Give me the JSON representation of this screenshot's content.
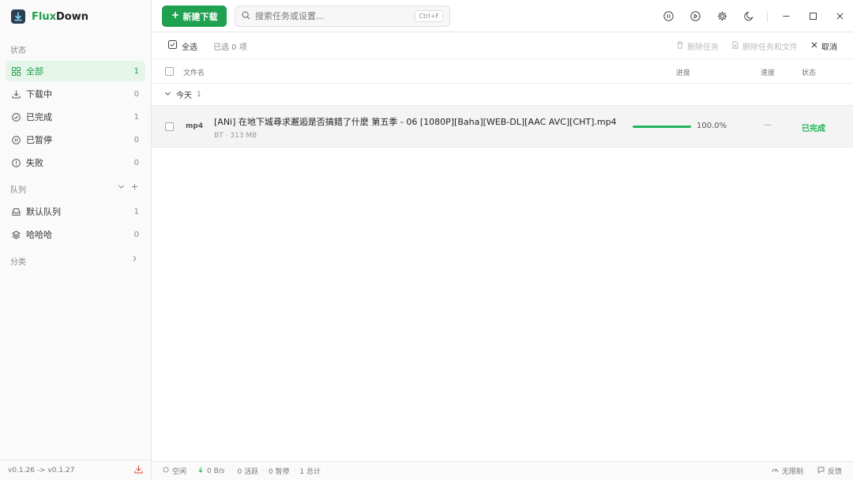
{
  "app": {
    "brand_prefix": "Flux",
    "brand_suffix": "Down"
  },
  "header": {
    "new_task_label": "新建下载",
    "search_placeholder": "搜索任务或设置...",
    "search_shortcut": "Ctrl+F"
  },
  "sidebar": {
    "status_label": "状态",
    "status_items": [
      {
        "label": "全部",
        "count": "1",
        "icon": "grid-icon"
      },
      {
        "label": "下载中",
        "count": "0",
        "icon": "download-icon"
      },
      {
        "label": "已完成",
        "count": "1",
        "icon": "check-circle-icon"
      },
      {
        "label": "已暂停",
        "count": "0",
        "icon": "pause-circle-icon"
      },
      {
        "label": "失败",
        "count": "0",
        "icon": "alert-circle-icon"
      }
    ],
    "queue_label": "队列",
    "queue_items": [
      {
        "label": "默认队列",
        "count": "1",
        "icon": "inbox-icon"
      },
      {
        "label": "哈哈哈",
        "count": "0",
        "icon": "layers-icon"
      }
    ],
    "category_label": "分类",
    "version": "v0.1.26 -> v0.1.27"
  },
  "toolbar": {
    "select_all": "全选",
    "selected_count": "已选 0 项",
    "delete_task": "删除任务",
    "delete_task_and_file": "删除任务和文件",
    "cancel": "取消"
  },
  "table": {
    "col_name": "文件名",
    "col_progress": "进度",
    "col_speed": "速度",
    "col_status": "状态"
  },
  "groups": [
    {
      "label": "今天",
      "count": "1",
      "tasks": [
        {
          "ext": "mp4",
          "name": "[ANi] 在地下城尋求邂逅是否搞錯了什麼 第五季 - 06 [1080P][Baha][WEB-DL][AAC AVC][CHT].mp4",
          "meta": "BT · 313 MB",
          "progress": 1.0,
          "progress_text": "100.0%",
          "speed": "—",
          "status": "已完成"
        }
      ]
    }
  ],
  "statusbar": {
    "state": "空闲",
    "speed": "0 B/s",
    "active": "0 活跃",
    "paused": "0 暂停",
    "total": "1 总计",
    "limit": "无限制",
    "feedback": "反馈"
  },
  "colors": {
    "accent": "#1fa150",
    "complete": "#22b55b",
    "active_bg": "#e6f5ea"
  }
}
